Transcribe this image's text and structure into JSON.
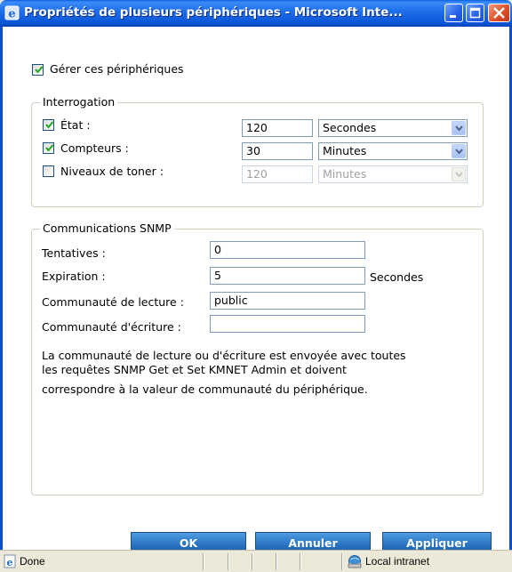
{
  "window": {
    "title": "Propriétés de plusieurs périphériques - Microsoft Inte...",
    "icon": "ie-icon",
    "controls": [
      "minimize-icon",
      "maximize-icon",
      "close-icon"
    ]
  },
  "manage": {
    "label": "Gérer ces périphériques",
    "checked": true
  },
  "polling": {
    "legend": "Interrogation",
    "rows": [
      {
        "label": "État :",
        "checked": true,
        "value": "120",
        "unit": "Secondes",
        "enabled": true
      },
      {
        "label": "Compteurs :",
        "checked": true,
        "value": "30",
        "unit": "Minutes",
        "enabled": true
      },
      {
        "label": "Niveaux de toner :",
        "checked": false,
        "value": "120",
        "unit": "Minutes",
        "enabled": false
      }
    ]
  },
  "snmp": {
    "legend": "Communications SNMP",
    "retries_label": "Tentatives :",
    "retries_value": "0",
    "timeout_label": "Expiration :",
    "timeout_value": "5",
    "timeout_unit": "Secondes",
    "read_label": "Communauté de lecture :",
    "read_value": "public",
    "write_label": "Communauté d'écriture :",
    "write_value": "",
    "note_line1": "La communauté de lecture ou d'écriture est envoyée avec toutes",
    "note_line2": "les requêtes SNMP Get et Set KMNET Admin et doivent",
    "note_line3": "correspondre à la valeur de communauté du périphérique."
  },
  "buttons": {
    "ok": "OK",
    "cancel": "Annuler",
    "apply": "Appliquer"
  },
  "status": {
    "text": "Done",
    "zone": "Local intranet"
  },
  "colors": {
    "titlebar": "#0b55d6",
    "button": "#2a75c3",
    "accent_check": "#21a121"
  }
}
